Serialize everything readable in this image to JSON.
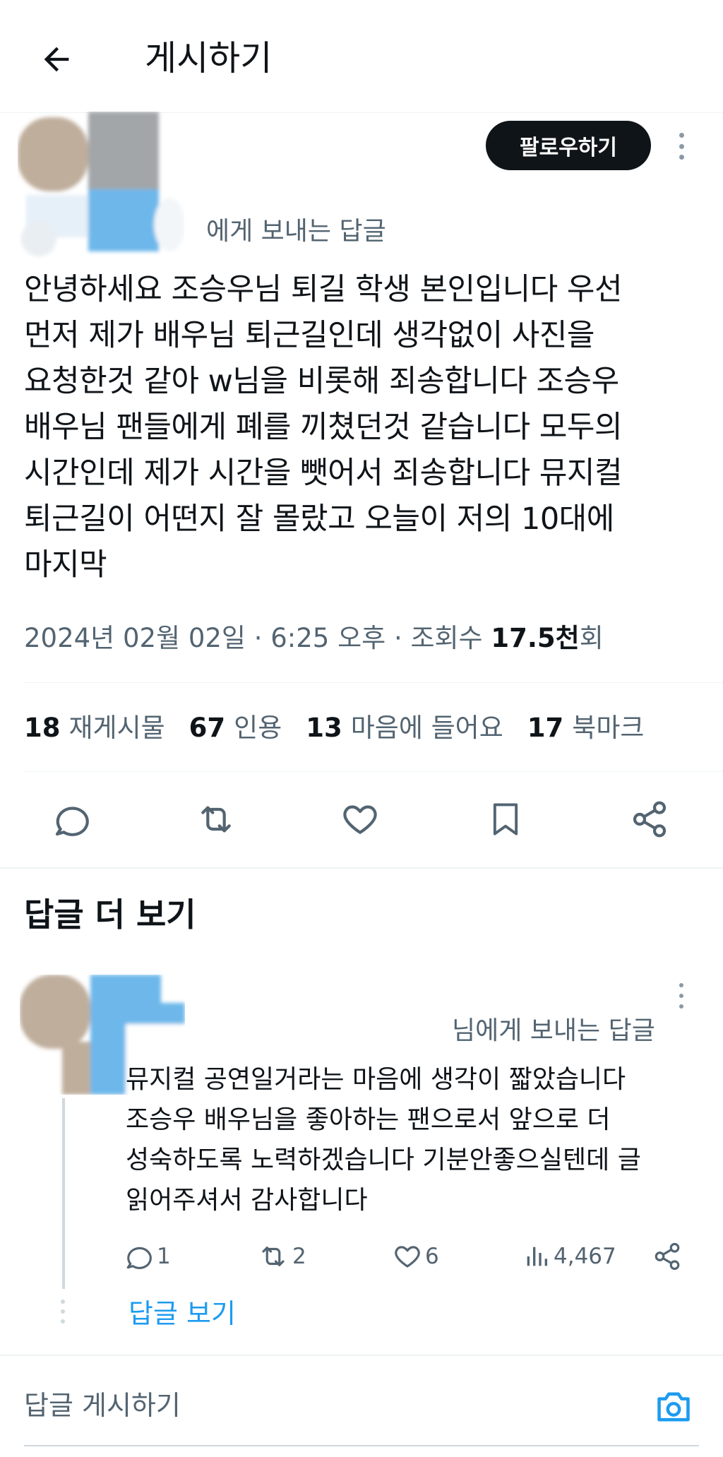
{
  "header": {
    "title": "게시하기"
  },
  "post": {
    "follow_label": "팔로우하기",
    "reply_to": "에게 보내는 답글",
    "text": "안녕하세요 조승우님 퇴길 학생 본인입니다 우선\n먼저 제가 배우님 퇴근길인데 생각없이 사진을\n요청한것 같아 w님을 비롯해 죄송합니다 조승우\n배우님 팬들에게 폐를 끼쳤던것 같습니다 모두의\n시간인데 제가 시간을 뺏어서 죄송합니다 뮤지컬\n퇴근길이 어떤지 잘 몰랐고 오늘이 저의 10대에\n마지막",
    "meta_date": "2024년 02월 02일 · 6:25 오후 · 조회수 ",
    "meta_views": "17.5천",
    "meta_views_suffix": "회",
    "stats": {
      "reposts_num": "18",
      "reposts_label": "재게시물",
      "quotes_num": "67",
      "quotes_label": "인용",
      "likes_num": "13",
      "likes_label": "마음에 들어요",
      "bookmarks_num": "17",
      "bookmarks_label": "북마크"
    }
  },
  "more_replies": {
    "title": "답글 더 보기"
  },
  "reply": {
    "reply_to": "님에게 보내는 답글",
    "text": "뮤지컬 공연일거라는 마음에 생각이 짧았습니다\n조승우 배우님을 좋아하는 팬으로서 앞으로 더\n성숙하도록 노력하겠습니다 기분안좋으실텐데 글\n읽어주셔서 감사합니다",
    "replies": "1",
    "reposts": "2",
    "likes": "6",
    "views": "4,467",
    "show_replies": "답글 보기"
  },
  "compose": {
    "placeholder": "답글 게시하기"
  },
  "colors": {
    "accent": "#1d9bf0",
    "text": "#0f1419",
    "muted": "#536471",
    "blur_skin": "#bfae9c",
    "blur_blue": "#6db7ea"
  },
  "icons": [
    "back-arrow-icon",
    "more-vertical-icon",
    "reply-icon",
    "repost-icon",
    "like-icon",
    "bookmark-icon",
    "share-icon",
    "views-icon",
    "camera-icon"
  ]
}
